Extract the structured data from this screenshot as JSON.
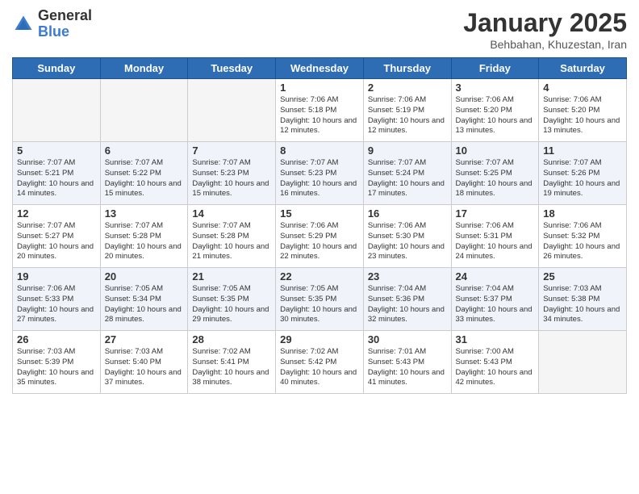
{
  "logo": {
    "general": "General",
    "blue": "Blue"
  },
  "title": "January 2025",
  "subtitle": "Behbahan, Khuzestan, Iran",
  "days_of_week": [
    "Sunday",
    "Monday",
    "Tuesday",
    "Wednesday",
    "Thursday",
    "Friday",
    "Saturday"
  ],
  "weeks": [
    {
      "shaded": false,
      "days": [
        {
          "day": "",
          "empty": true
        },
        {
          "day": "",
          "empty": true
        },
        {
          "day": "",
          "empty": true
        },
        {
          "day": "1",
          "sunrise": "7:06 AM",
          "sunset": "5:18 PM",
          "daylight": "10 hours and 12 minutes."
        },
        {
          "day": "2",
          "sunrise": "7:06 AM",
          "sunset": "5:19 PM",
          "daylight": "10 hours and 12 minutes."
        },
        {
          "day": "3",
          "sunrise": "7:06 AM",
          "sunset": "5:20 PM",
          "daylight": "10 hours and 13 minutes."
        },
        {
          "day": "4",
          "sunrise": "7:06 AM",
          "sunset": "5:20 PM",
          "daylight": "10 hours and 13 minutes."
        }
      ]
    },
    {
      "shaded": true,
      "days": [
        {
          "day": "5",
          "sunrise": "7:07 AM",
          "sunset": "5:21 PM",
          "daylight": "10 hours and 14 minutes."
        },
        {
          "day": "6",
          "sunrise": "7:07 AM",
          "sunset": "5:22 PM",
          "daylight": "10 hours and 15 minutes."
        },
        {
          "day": "7",
          "sunrise": "7:07 AM",
          "sunset": "5:23 PM",
          "daylight": "10 hours and 15 minutes."
        },
        {
          "day": "8",
          "sunrise": "7:07 AM",
          "sunset": "5:23 PM",
          "daylight": "10 hours and 16 minutes."
        },
        {
          "day": "9",
          "sunrise": "7:07 AM",
          "sunset": "5:24 PM",
          "daylight": "10 hours and 17 minutes."
        },
        {
          "day": "10",
          "sunrise": "7:07 AM",
          "sunset": "5:25 PM",
          "daylight": "10 hours and 18 minutes."
        },
        {
          "day": "11",
          "sunrise": "7:07 AM",
          "sunset": "5:26 PM",
          "daylight": "10 hours and 19 minutes."
        }
      ]
    },
    {
      "shaded": false,
      "days": [
        {
          "day": "12",
          "sunrise": "7:07 AM",
          "sunset": "5:27 PM",
          "daylight": "10 hours and 20 minutes."
        },
        {
          "day": "13",
          "sunrise": "7:07 AM",
          "sunset": "5:28 PM",
          "daylight": "10 hours and 20 minutes."
        },
        {
          "day": "14",
          "sunrise": "7:07 AM",
          "sunset": "5:28 PM",
          "daylight": "10 hours and 21 minutes."
        },
        {
          "day": "15",
          "sunrise": "7:06 AM",
          "sunset": "5:29 PM",
          "daylight": "10 hours and 22 minutes."
        },
        {
          "day": "16",
          "sunrise": "7:06 AM",
          "sunset": "5:30 PM",
          "daylight": "10 hours and 23 minutes."
        },
        {
          "day": "17",
          "sunrise": "7:06 AM",
          "sunset": "5:31 PM",
          "daylight": "10 hours and 24 minutes."
        },
        {
          "day": "18",
          "sunrise": "7:06 AM",
          "sunset": "5:32 PM",
          "daylight": "10 hours and 26 minutes."
        }
      ]
    },
    {
      "shaded": true,
      "days": [
        {
          "day": "19",
          "sunrise": "7:06 AM",
          "sunset": "5:33 PM",
          "daylight": "10 hours and 27 minutes."
        },
        {
          "day": "20",
          "sunrise": "7:05 AM",
          "sunset": "5:34 PM",
          "daylight": "10 hours and 28 minutes."
        },
        {
          "day": "21",
          "sunrise": "7:05 AM",
          "sunset": "5:35 PM",
          "daylight": "10 hours and 29 minutes."
        },
        {
          "day": "22",
          "sunrise": "7:05 AM",
          "sunset": "5:35 PM",
          "daylight": "10 hours and 30 minutes."
        },
        {
          "day": "23",
          "sunrise": "7:04 AM",
          "sunset": "5:36 PM",
          "daylight": "10 hours and 32 minutes."
        },
        {
          "day": "24",
          "sunrise": "7:04 AM",
          "sunset": "5:37 PM",
          "daylight": "10 hours and 33 minutes."
        },
        {
          "day": "25",
          "sunrise": "7:03 AM",
          "sunset": "5:38 PM",
          "daylight": "10 hours and 34 minutes."
        }
      ]
    },
    {
      "shaded": false,
      "days": [
        {
          "day": "26",
          "sunrise": "7:03 AM",
          "sunset": "5:39 PM",
          "daylight": "10 hours and 35 minutes."
        },
        {
          "day": "27",
          "sunrise": "7:03 AM",
          "sunset": "5:40 PM",
          "daylight": "10 hours and 37 minutes."
        },
        {
          "day": "28",
          "sunrise": "7:02 AM",
          "sunset": "5:41 PM",
          "daylight": "10 hours and 38 minutes."
        },
        {
          "day": "29",
          "sunrise": "7:02 AM",
          "sunset": "5:42 PM",
          "daylight": "10 hours and 40 minutes."
        },
        {
          "day": "30",
          "sunrise": "7:01 AM",
          "sunset": "5:43 PM",
          "daylight": "10 hours and 41 minutes."
        },
        {
          "day": "31",
          "sunrise": "7:00 AM",
          "sunset": "5:43 PM",
          "daylight": "10 hours and 42 minutes."
        },
        {
          "day": "",
          "empty": true
        }
      ]
    }
  ]
}
